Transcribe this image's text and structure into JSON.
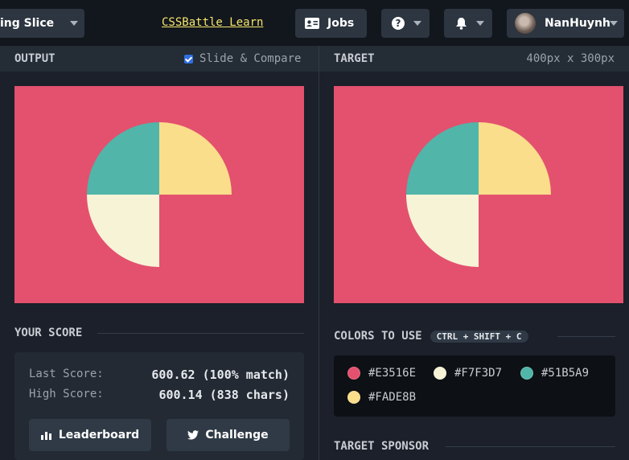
{
  "topbar": {
    "challenge_dropdown_label": "ing Slice",
    "learn_link": "CSSBattle Learn",
    "jobs_label": "Jobs",
    "help_icon": "question-icon",
    "bell_icon": "bell-icon",
    "user_name": "NanHuynh"
  },
  "output_panel": {
    "title": "OUTPUT",
    "slide_compare_label": "Slide & Compare",
    "slide_compare_checked": true
  },
  "target_panel": {
    "title": "TARGET",
    "dimensions": "400px x 300px"
  },
  "canvas": {
    "background": "#E3516E",
    "teal": "#51B5A9",
    "yellow": "#FADE8B",
    "cream": "#F7F3D7"
  },
  "score": {
    "title": "YOUR SCORE",
    "last_label": "Last Score:",
    "last_value": "600.62 (100% match)",
    "high_label": "High Score:",
    "high_value": "600.14 (838 chars)",
    "leaderboard_label": "Leaderboard",
    "challenge_label": "Challenge"
  },
  "colors": {
    "title": "COLORS TO USE",
    "shortcut": "CTRL + SHIFT + C",
    "items": [
      {
        "hex": "#E3516E",
        "label": "#E3516E"
      },
      {
        "hex": "#F7F3D7",
        "label": "#F7F3D7"
      },
      {
        "hex": "#51B5A9",
        "label": "#51B5A9"
      },
      {
        "hex": "#FADE8B",
        "label": "#FADE8B"
      }
    ]
  },
  "sponsor": {
    "title": "TARGET SPONSOR"
  }
}
